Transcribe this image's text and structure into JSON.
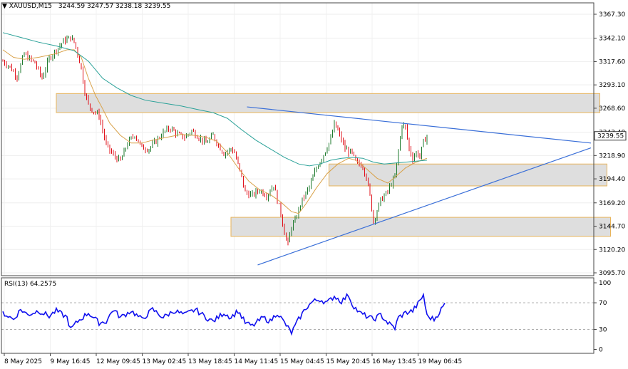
{
  "chart_data": [
    {
      "type": "candlestick",
      "symbol_header": "XAUUSD,M15",
      "ohlc_header": "3244.59 3247.57 3238.18 3239.55",
      "current_price_label": "3239.55",
      "y_tick_labels": [
        "3367.30",
        "3342.10",
        "3317.60",
        "3293.10",
        "3268.60",
        "3243.40",
        "3218.90",
        "3194.40",
        "3169.20",
        "3144.70",
        "3120.20",
        "3095.70"
      ],
      "y_ticks": [
        3367.3,
        3342.1,
        3317.6,
        3293.1,
        3268.6,
        3243.4,
        3218.9,
        3194.4,
        3169.2,
        3144.7,
        3120.2,
        3095.7
      ],
      "ylim": [
        3095.7,
        3367.3
      ],
      "x_tick_labels": [
        "8 May 2025",
        "9 May 16:45",
        "12 May 09:45",
        "13 May 02:45",
        "13 May 18:45",
        "14 May 11:45",
        "15 May 04:45",
        "15 May 20:45",
        "16 May 13:45",
        "19 May 06:45"
      ],
      "price_path": [
        [
          0,
          3318
        ],
        [
          4,
          3312
        ],
        [
          8,
          3302
        ],
        [
          12,
          3326
        ],
        [
          14,
          3322
        ],
        [
          18,
          3316
        ],
        [
          22,
          3300
        ],
        [
          26,
          3321
        ],
        [
          30,
          3330
        ],
        [
          34,
          3339
        ],
        [
          38,
          3343
        ],
        [
          40,
          3338
        ],
        [
          42,
          3326
        ],
        [
          44,
          3310
        ],
        [
          46,
          3286
        ],
        [
          48,
          3272
        ],
        [
          50,
          3267
        ],
        [
          54,
          3261
        ],
        [
          58,
          3230
        ],
        [
          62,
          3219
        ],
        [
          66,
          3213
        ],
        [
          70,
          3232
        ],
        [
          74,
          3241
        ],
        [
          78,
          3227
        ],
        [
          82,
          3226
        ],
        [
          86,
          3234
        ],
        [
          90,
          3243
        ],
        [
          94,
          3248
        ],
        [
          98,
          3241
        ],
        [
          102,
          3238
        ],
        [
          106,
          3245
        ],
        [
          110,
          3238
        ],
        [
          114,
          3232
        ],
        [
          118,
          3240
        ],
        [
          120,
          3233
        ],
        [
          124,
          3221
        ],
        [
          128,
          3226
        ],
        [
          130,
          3222
        ],
        [
          134,
          3196
        ],
        [
          136,
          3180
        ],
        [
          140,
          3177
        ],
        [
          144,
          3183
        ],
        [
          148,
          3177
        ],
        [
          152,
          3188
        ],
        [
          154,
          3172
        ],
        [
          156,
          3158
        ],
        [
          158,
          3138
        ],
        [
          160,
          3125
        ],
        [
          162,
          3145
        ],
        [
          164,
          3150
        ],
        [
          166,
          3162
        ],
        [
          168,
          3172
        ],
        [
          172,
          3186
        ],
        [
          176,
          3206
        ],
        [
          180,
          3220
        ],
        [
          184,
          3236
        ],
        [
          186,
          3252
        ],
        [
          188,
          3245
        ],
        [
          192,
          3226
        ],
        [
          196,
          3221
        ],
        [
          198,
          3212
        ],
        [
          202,
          3208
        ],
        [
          204,
          3196
        ],
        [
          206,
          3176
        ],
        [
          208,
          3150
        ],
        [
          210,
          3161
        ],
        [
          212,
          3172
        ],
        [
          216,
          3181
        ],
        [
          218,
          3190
        ],
        [
          220,
          3196
        ],
        [
          222,
          3224
        ],
        [
          224,
          3252
        ],
        [
          226,
          3248
        ],
        [
          228,
          3226
        ],
        [
          230,
          3216
        ],
        [
          232,
          3222
        ],
        [
          234,
          3218
        ],
        [
          236,
          3233
        ],
        [
          238,
          3240
        ]
      ],
      "series": [
        {
          "name": "",
          "color": "#d9a24a",
          "values_path": [
            [
              0,
              3330
            ],
            [
              6,
              3322
            ],
            [
              12,
              3320
            ],
            [
              20,
              3322
            ],
            [
              30,
              3326
            ],
            [
              36,
              3330
            ],
            [
              40,
              3330
            ],
            [
              44,
              3322
            ],
            [
              48,
              3300
            ],
            [
              52,
              3282
            ],
            [
              56,
              3268
            ],
            [
              60,
              3253
            ],
            [
              66,
              3240
            ],
            [
              72,
              3232
            ],
            [
              78,
              3232
            ],
            [
              84,
              3235
            ],
            [
              92,
              3238
            ],
            [
              100,
              3241
            ],
            [
              108,
              3240
            ],
            [
              114,
              3238
            ],
            [
              120,
              3234
            ],
            [
              126,
              3222
            ],
            [
              132,
              3206
            ],
            [
              138,
              3192
            ],
            [
              144,
              3183
            ],
            [
              150,
              3178
            ],
            [
              156,
              3170
            ],
            [
              162,
              3160
            ],
            [
              166,
              3158
            ],
            [
              170,
              3168
            ],
            [
              176,
              3185
            ],
            [
              182,
              3200
            ],
            [
              188,
              3210
            ],
            [
              194,
              3216
            ],
            [
              198,
              3214
            ],
            [
              204,
              3205
            ],
            [
              210,
              3195
            ],
            [
              216,
              3190
            ],
            [
              220,
              3196
            ],
            [
              226,
              3206
            ],
            [
              232,
              3212
            ],
            [
              238,
              3216
            ]
          ]
        },
        {
          "name": "",
          "color": "#2aa198",
          "values_path": [
            [
              0,
              3348
            ],
            [
              10,
              3343
            ],
            [
              20,
              3338
            ],
            [
              30,
              3334
            ],
            [
              40,
              3329
            ],
            [
              48,
              3318
            ],
            [
              56,
              3300
            ],
            [
              64,
              3290
            ],
            [
              72,
              3282
            ],
            [
              80,
              3277
            ],
            [
              90,
              3274
            ],
            [
              100,
              3271
            ],
            [
              110,
              3267
            ],
            [
              118,
              3264
            ],
            [
              126,
              3258
            ],
            [
              134,
              3246
            ],
            [
              142,
              3235
            ],
            [
              150,
              3226
            ],
            [
              158,
              3217
            ],
            [
              166,
              3210
            ],
            [
              172,
              3208
            ],
            [
              178,
              3210
            ],
            [
              184,
              3214
            ],
            [
              190,
              3216
            ],
            [
              196,
              3217
            ],
            [
              202,
              3216
            ],
            [
              208,
              3212
            ],
            [
              214,
              3210
            ],
            [
              220,
              3211
            ],
            [
              226,
              3212
            ],
            [
              232,
              3213
            ],
            [
              238,
              3214
            ]
          ]
        }
      ],
      "zones": [
        {
          "from": 3264,
          "to": 3284,
          "start_bar": 30,
          "end_bar": 335
        },
        {
          "from": 3187,
          "to": 3210,
          "start_bar": 183,
          "end_bar": 339
        },
        {
          "from": 3134,
          "to": 3154,
          "start_bar": 128,
          "end_bar": 341
        }
      ],
      "trendlines": [
        {
          "color": "#3a6fd8",
          "from_bar": 137,
          "from_price": 3270,
          "to_bar": 330,
          "to_price": 3232
        },
        {
          "color": "#3a6fd8",
          "from_bar": 143,
          "from_price": 3104,
          "to_bar": 330,
          "to_price": 3227
        }
      ],
      "grid": true,
      "legend": "none"
    },
    {
      "type": "line",
      "title": "RSI(13) 64.2575",
      "color": "#1010ee",
      "ylim": [
        0,
        100
      ],
      "y_tick_labels": [
        "100",
        "70",
        "30",
        "0"
      ],
      "y_ticks": [
        100,
        70,
        30,
        0
      ],
      "levels": [
        70,
        30
      ],
      "rsi_path": [
        [
          0,
          55
        ],
        [
          6,
          45
        ],
        [
          10,
          60
        ],
        [
          14,
          52
        ],
        [
          20,
          58
        ],
        [
          26,
          50
        ],
        [
          30,
          58
        ],
        [
          36,
          48
        ],
        [
          38,
          30
        ],
        [
          42,
          42
        ],
        [
          48,
          55
        ],
        [
          54,
          40
        ],
        [
          58,
          42
        ],
        [
          62,
          60
        ],
        [
          66,
          48
        ],
        [
          72,
          58
        ],
        [
          78,
          45
        ],
        [
          84,
          60
        ],
        [
          90,
          48
        ],
        [
          96,
          58
        ],
        [
          102,
          52
        ],
        [
          108,
          60
        ],
        [
          114,
          48
        ],
        [
          118,
          42
        ],
        [
          124,
          55
        ],
        [
          128,
          48
        ],
        [
          132,
          58
        ],
        [
          136,
          40
        ],
        [
          140,
          35
        ],
        [
          146,
          48
        ],
        [
          150,
          42
        ],
        [
          154,
          55
        ],
        [
          158,
          40
        ],
        [
          162,
          25
        ],
        [
          166,
          45
        ],
        [
          170,
          62
        ],
        [
          174,
          72
        ],
        [
          178,
          75
        ],
        [
          182,
          70
        ],
        [
          186,
          80
        ],
        [
          190,
          72
        ],
        [
          194,
          82
        ],
        [
          196,
          68
        ],
        [
          200,
          55
        ],
        [
          204,
          50
        ],
        [
          208,
          45
        ],
        [
          212,
          52
        ],
        [
          216,
          40
        ],
        [
          220,
          32
        ],
        [
          222,
          48
        ],
        [
          226,
          55
        ],
        [
          230,
          58
        ],
        [
          234,
          72
        ],
        [
          236,
          82
        ],
        [
          238,
          50
        ],
        [
          242,
          45
        ],
        [
          246,
          60
        ],
        [
          248,
          68
        ]
      ]
    }
  ]
}
